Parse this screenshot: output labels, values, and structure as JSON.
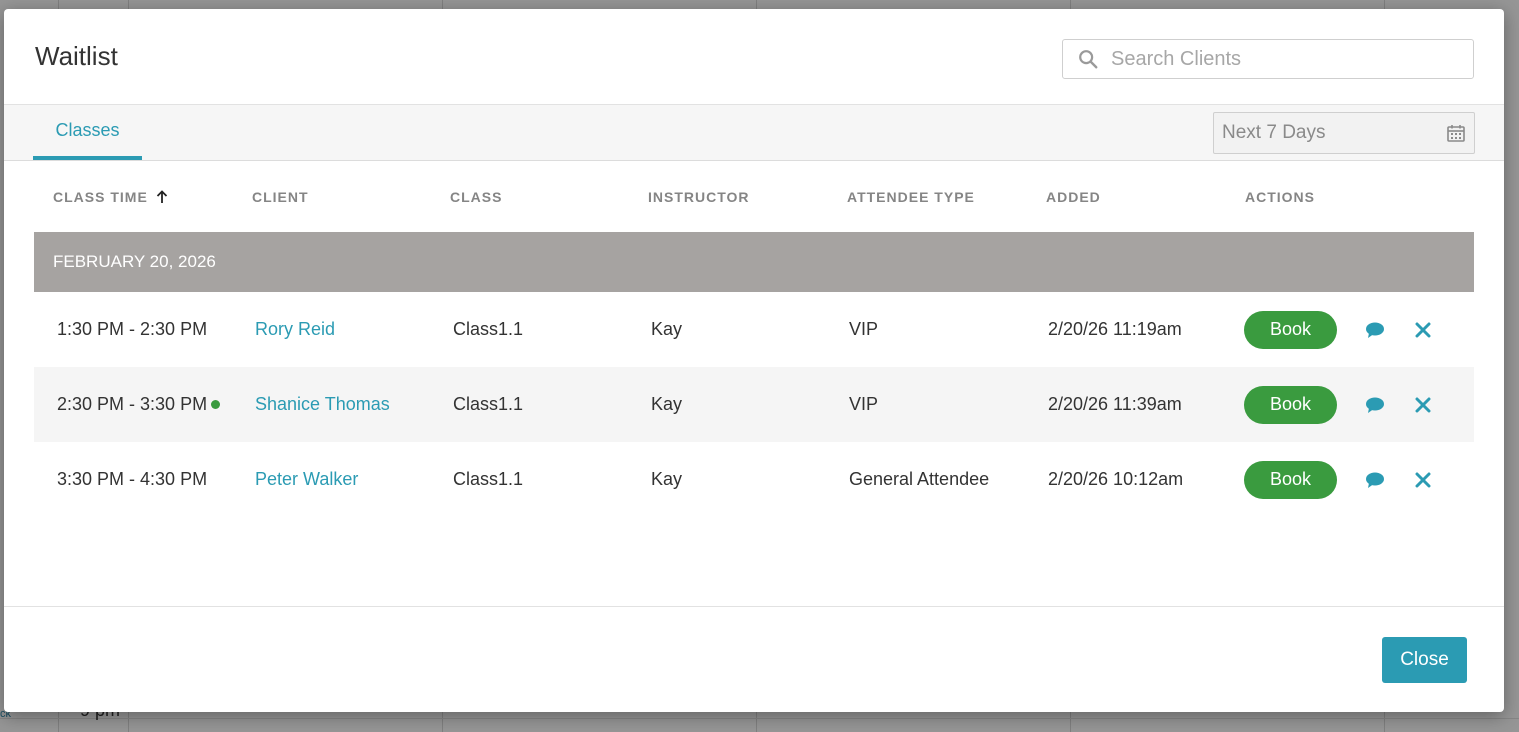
{
  "background": {
    "time_label": "9 pm",
    "edge_text": "ck"
  },
  "modal": {
    "title": "Waitlist",
    "search": {
      "placeholder": "Search Clients",
      "value": ""
    },
    "tabs": [
      {
        "label": "Classes",
        "active": true
      }
    ],
    "date_range": {
      "value": "Next 7 Days"
    },
    "columns": [
      {
        "label": "CLASS TIME",
        "sorted": "asc"
      },
      {
        "label": "CLIENT"
      },
      {
        "label": "CLASS"
      },
      {
        "label": "INSTRUCTOR"
      },
      {
        "label": "ATTENDEE TYPE"
      },
      {
        "label": "ADDED"
      },
      {
        "label": "ACTIONS"
      }
    ],
    "groups": [
      {
        "date_label": "FEBRUARY 20, 2026",
        "rows": [
          {
            "class_time": "1:30 PM - 2:30 PM",
            "status_dot": false,
            "client": "Rory Reid",
            "class": "Class1.1",
            "instructor": "Kay",
            "attendee_type": "VIP",
            "added": "2/20/26 11:19am",
            "book_label": "Book"
          },
          {
            "class_time": "2:30 PM - 3:30 PM",
            "status_dot": true,
            "client": "Shanice Thomas",
            "class": "Class1.1",
            "instructor": "Kay",
            "attendee_type": "VIP",
            "added": "2/20/26 11:39am",
            "book_label": "Book"
          },
          {
            "class_time": "3:30 PM - 4:30 PM",
            "status_dot": false,
            "client": "Peter Walker",
            "class": "Class1.1",
            "instructor": "Kay",
            "attendee_type": "General Attendee",
            "added": "2/20/26 10:12am",
            "book_label": "Book"
          }
        ]
      }
    ],
    "footer": {
      "close_label": "Close"
    }
  },
  "colors": {
    "accent": "#2b9bb3",
    "book_green": "#3a9b3f",
    "group_header": "#a6a3a1"
  },
  "icons": {
    "search": "search-icon",
    "calendar": "calendar-icon",
    "sort": "arrow-up-icon",
    "message": "chat-bubble-icon",
    "remove": "close-x-icon"
  }
}
